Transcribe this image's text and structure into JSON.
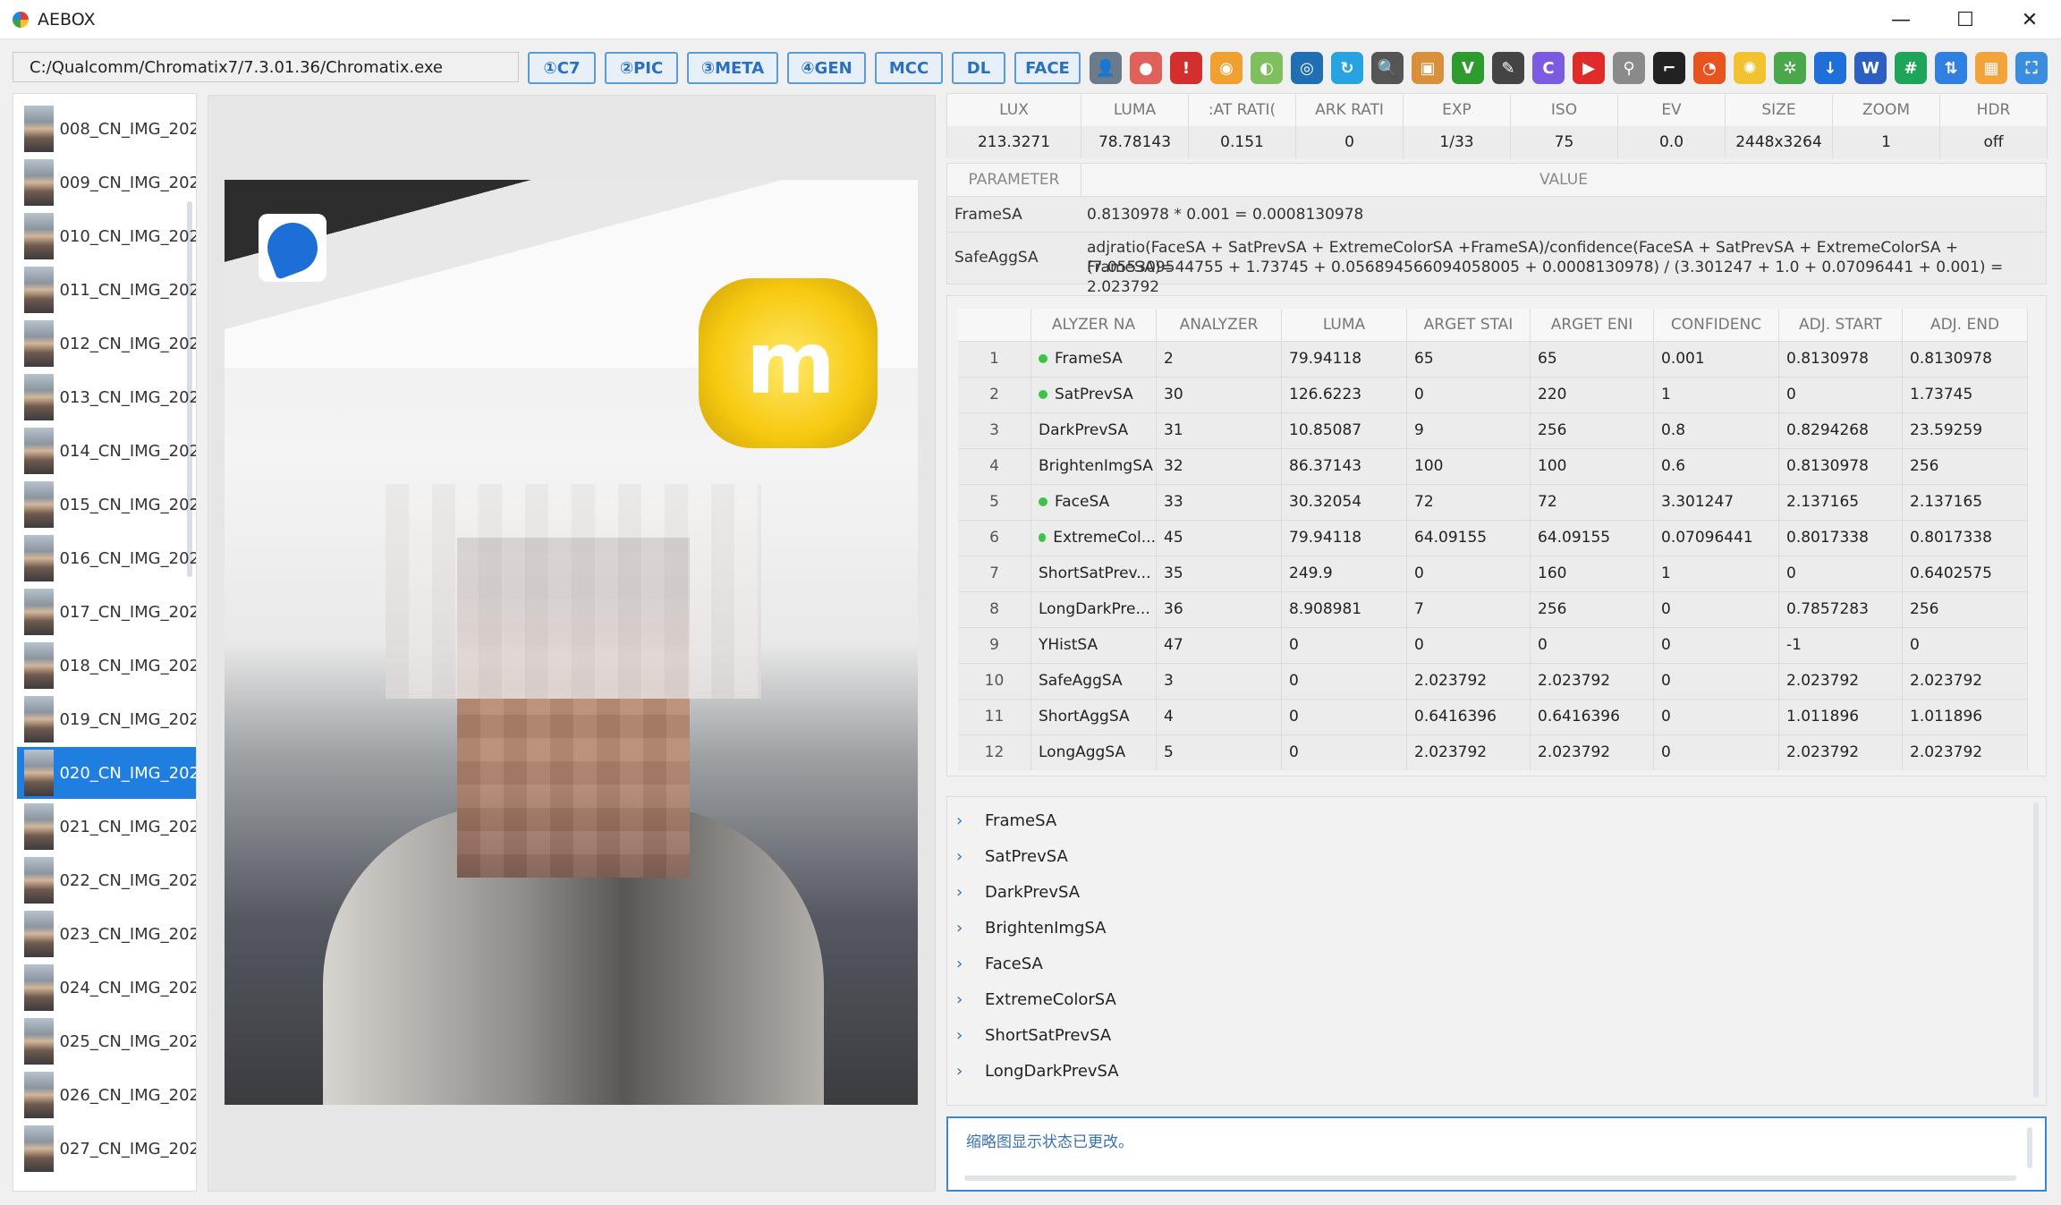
{
  "window": {
    "title": "AEBOX",
    "minimize": "—",
    "maximize": "☐",
    "close": "✕"
  },
  "toolbar": {
    "path_value": "C:/Qualcomm/Chromatix7/7.3.01.36/Chromatix.exe",
    "buttons": [
      "①C7",
      "②PIC",
      "③META",
      "④GEN",
      "MCC",
      "DL",
      "FACE"
    ]
  },
  "icon_strip": [
    {
      "name": "user-icon",
      "color": "#6b7b8c",
      "glyph": "👤"
    },
    {
      "name": "stop-icon",
      "color": "#e0605a",
      "glyph": "●"
    },
    {
      "name": "alert-icon",
      "color": "#d32f2f",
      "glyph": "!"
    },
    {
      "name": "color-wheel-icon",
      "color": "#f0a030",
      "glyph": "◉"
    },
    {
      "name": "toggle-icon",
      "color": "#7fbf5f",
      "glyph": "◐"
    },
    {
      "name": "aperture-icon",
      "color": "#1f6fb2",
      "glyph": "◎"
    },
    {
      "name": "refresh-icon",
      "color": "#27a3e0",
      "glyph": "↻"
    },
    {
      "name": "magnifier-icon",
      "color": "#555555",
      "glyph": "🔍"
    },
    {
      "name": "image-icon",
      "color": "#d9903a",
      "glyph": "▣"
    },
    {
      "name": "check-v-icon",
      "color": "#2e9b2e",
      "glyph": "V"
    },
    {
      "name": "note-icon",
      "color": "#444444",
      "glyph": "✎"
    },
    {
      "name": "c-letter-icon",
      "color": "#7b5ce0",
      "glyph": "C"
    },
    {
      "name": "play-icon",
      "color": "#e02b2b",
      "glyph": "▶"
    },
    {
      "name": "usb-icon",
      "color": "#8a8a8a",
      "glyph": "⚲"
    },
    {
      "name": "crop-icon",
      "color": "#222222",
      "glyph": "⌐"
    },
    {
      "name": "browser-icon",
      "color": "#e8541f",
      "glyph": "◔"
    },
    {
      "name": "bulb-icon",
      "color": "#f2c230",
      "glyph": "✺"
    },
    {
      "name": "settings-icon",
      "color": "#4aa84a",
      "glyph": "✲"
    },
    {
      "name": "download-icon",
      "color": "#1e6fd8",
      "glyph": "↓"
    },
    {
      "name": "word-icon",
      "color": "#2b5fc4",
      "glyph": "W"
    },
    {
      "name": "hash-icon",
      "color": "#1fa55a",
      "glyph": "#"
    },
    {
      "name": "transfer-icon",
      "color": "#2f80e0",
      "glyph": "⇅"
    },
    {
      "name": "grid-icon",
      "color": "#f2a33a",
      "glyph": "▦"
    },
    {
      "name": "capture-icon",
      "color": "#3a8ee0",
      "glyph": "⛶"
    }
  ],
  "thumbnails": [
    {
      "label": "008_CN_IMG_202",
      "selected": false
    },
    {
      "label": "009_CN_IMG_202",
      "selected": false
    },
    {
      "label": "010_CN_IMG_202",
      "selected": false
    },
    {
      "label": "011_CN_IMG_202",
      "selected": false
    },
    {
      "label": "012_CN_IMG_202",
      "selected": false
    },
    {
      "label": "013_CN_IMG_202",
      "selected": false
    },
    {
      "label": "014_CN_IMG_202",
      "selected": false
    },
    {
      "label": "015_CN_IMG_202",
      "selected": false
    },
    {
      "label": "016_CN_IMG_202",
      "selected": false
    },
    {
      "label": "017_CN_IMG_202",
      "selected": false
    },
    {
      "label": "018_CN_IMG_202",
      "selected": false
    },
    {
      "label": "019_CN_IMG_202",
      "selected": false
    },
    {
      "label": "020_CN_IMG_202",
      "selected": true
    },
    {
      "label": "021_CN_IMG_202",
      "selected": false
    },
    {
      "label": "022_CN_IMG_202",
      "selected": false
    },
    {
      "label": "023_CN_IMG_202",
      "selected": false
    },
    {
      "label": "024_CN_IMG_202",
      "selected": false
    },
    {
      "label": "025_CN_IMG_202",
      "selected": false
    },
    {
      "label": "026_CN_IMG_202",
      "selected": false
    },
    {
      "label": "027_CN_IMG_202",
      "selected": false
    }
  ],
  "info": {
    "headers": [
      "LUX",
      "LUMA",
      "SAT RATIO",
      "DARK RATIO",
      "EXP",
      "ISO",
      "EV",
      "SIZE",
      "ZOOM",
      "HDR"
    ],
    "headers_display": [
      "LUX",
      "LUMA",
      ":AT RATI(",
      "ARK RATI",
      "EXP",
      "ISO",
      "EV",
      "SIZE",
      "ZOOM",
      "HDR"
    ],
    "values": [
      "213.3271",
      "78.78143",
      "0.151",
      "0",
      "1/33",
      "75",
      "0.0",
      "2448x3264",
      "1",
      "off"
    ]
  },
  "params": {
    "header_name": "PARAMETER",
    "header_value": "VALUE",
    "rows": [
      {
        "name": "FrameSA",
        "value_lines": [
          "0.8130978 * 0.001 = 0.0008130978"
        ]
      },
      {
        "name": "SafeAggSA",
        "value_lines": [
          "adjratio(FaceSA + SatPrevSA + ExtremeColorSA +FrameSA)/confidence(FaceSA + SatPrevSA + ExtremeColorSA + FrameSA)=",
          "(7.055309544755 + 1.73745 + 0.056894566094058005 + 0.0008130978) / (3.301247 + 1.0 + 0.07096441 + 0.001) = 2.023792"
        ]
      }
    ]
  },
  "analyzer": {
    "headers": [
      "",
      "ALYZER NA",
      "ANALYZER",
      "LUMA",
      "ARGET STAI",
      "ARGET ENI",
      "CONFIDENC",
      "ADJ. START",
      "ADJ. END"
    ],
    "rows": [
      {
        "idx": "1",
        "name": "FrameSA",
        "dot": true,
        "analyzer": "2",
        "luma": "79.94118",
        "target_start": "65",
        "target_end": "65",
        "confidence": "0.001",
        "adj_start": "0.8130978",
        "adj_end": "0.8130978"
      },
      {
        "idx": "2",
        "name": "SatPrevSA",
        "dot": true,
        "analyzer": "30",
        "luma": "126.6223",
        "target_start": "0",
        "target_end": "220",
        "confidence": "1",
        "adj_start": "0",
        "adj_end": "1.73745"
      },
      {
        "idx": "3",
        "name": "DarkPrevSA",
        "dot": false,
        "analyzer": "31",
        "luma": "10.85087",
        "target_start": "9",
        "target_end": "256",
        "confidence": "0.8",
        "adj_start": "0.8294268",
        "adj_end": "23.59259"
      },
      {
        "idx": "4",
        "name": "BrightenImgSA",
        "dot": false,
        "analyzer": "32",
        "luma": "86.37143",
        "target_start": "100",
        "target_end": "100",
        "confidence": "0.6",
        "adj_start": "0.8130978",
        "adj_end": "256"
      },
      {
        "idx": "5",
        "name": "FaceSA",
        "dot": true,
        "analyzer": "33",
        "luma": "30.32054",
        "target_start": "72",
        "target_end": "72",
        "confidence": "3.301247",
        "adj_start": "2.137165",
        "adj_end": "2.137165"
      },
      {
        "idx": "6",
        "name": "ExtremeCol...",
        "dot": true,
        "analyzer": "45",
        "luma": "79.94118",
        "target_start": "64.09155",
        "target_end": "64.09155",
        "confidence": "0.07096441",
        "adj_start": "0.8017338",
        "adj_end": "0.8017338"
      },
      {
        "idx": "7",
        "name": "ShortSatPrev...",
        "dot": false,
        "analyzer": "35",
        "luma": "249.9",
        "target_start": "0",
        "target_end": "160",
        "confidence": "1",
        "adj_start": "0",
        "adj_end": "0.6402575"
      },
      {
        "idx": "8",
        "name": "LongDarkPre...",
        "dot": false,
        "analyzer": "36",
        "luma": "8.908981",
        "target_start": "7",
        "target_end": "256",
        "confidence": "0",
        "adj_start": "0.7857283",
        "adj_end": "256"
      },
      {
        "idx": "9",
        "name": "YHistSA",
        "dot": false,
        "analyzer": "47",
        "luma": "0",
        "target_start": "0",
        "target_end": "0",
        "confidence": "0",
        "adj_start": "-1",
        "adj_end": "0"
      },
      {
        "idx": "10",
        "name": "SafeAggSA",
        "dot": false,
        "analyzer": "3",
        "luma": "0",
        "target_start": "2.023792",
        "target_end": "2.023792",
        "confidence": "0",
        "adj_start": "2.023792",
        "adj_end": "2.023792"
      },
      {
        "idx": "11",
        "name": "ShortAggSA",
        "dot": false,
        "analyzer": "4",
        "luma": "0",
        "target_start": "0.6416396",
        "target_end": "0.6416396",
        "confidence": "0",
        "adj_start": "1.011896",
        "adj_end": "1.011896"
      },
      {
        "idx": "12",
        "name": "LongAggSA",
        "dot": false,
        "analyzer": "5",
        "luma": "0",
        "target_start": "2.023792",
        "target_end": "2.023792",
        "confidence": "0",
        "adj_start": "2.023792",
        "adj_end": "2.023792"
      }
    ]
  },
  "tree": [
    "FrameSA",
    "SatPrevSA",
    "DarkPrevSA",
    "BrightenImgSA",
    "FaceSA",
    "ExtremeColorSA",
    "ShortSatPrevSA",
    "LongDarkPrevSA"
  ],
  "log": {
    "message": "缩略图显示状态已更改。"
  },
  "colors": {
    "accent": "#1e7fe0",
    "button_border": "#5b9bd5",
    "status_dot": "#3cc448"
  }
}
